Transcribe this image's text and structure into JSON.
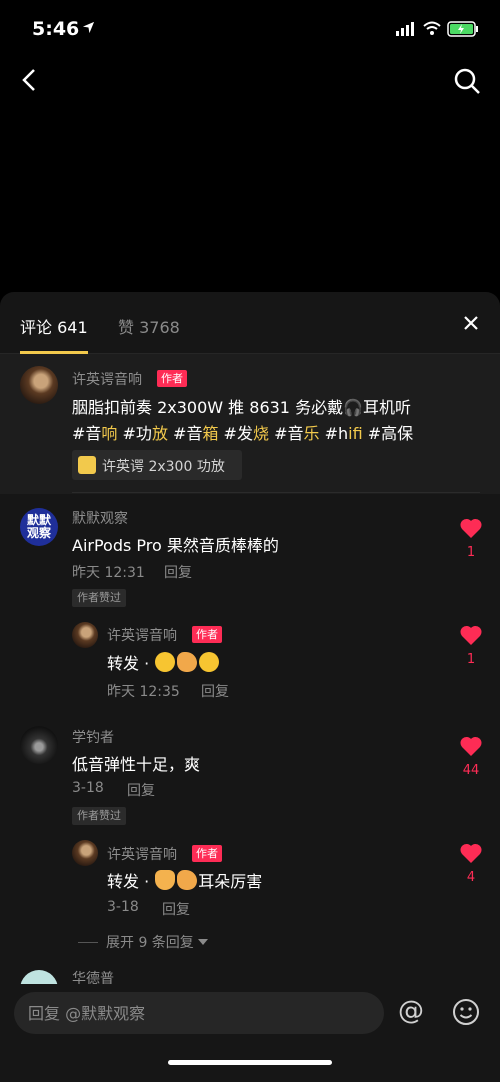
{
  "status": {
    "time": "5:46"
  },
  "tabs": {
    "comments": "评论 641",
    "likes": "赞 3768"
  },
  "pinned": {
    "username": "许英谔音响",
    "author_badge": "作者",
    "line1": "胭脂扣前奏 2x300W 推 8631 务必戴🎧耳机听",
    "tags": [
      {
        "a": "#音",
        "b": "响"
      },
      {
        "a": " #功",
        "b": "放"
      },
      {
        "a": " #音",
        "b": "箱"
      },
      {
        "a": " #发",
        "b": "烧"
      },
      {
        "a": " #音",
        "b": "乐"
      },
      {
        "a": " #h",
        "b": "ifi"
      },
      {
        "a": " #高保",
        "b": ""
      }
    ],
    "product": "许英谔 2x300 功放"
  },
  "comments": [
    {
      "username": "默默观察",
      "avatar_text": [
        "默默",
        "观察"
      ],
      "text": "AirPods Pro 果然音质棒棒的",
      "time": "昨天 12:31",
      "reply": "回复",
      "liked_by_author": "作者赞过",
      "likes": "1"
    },
    {
      "username": "许英谔音响",
      "author_badge": "作者",
      "text": "转发 ·",
      "time": "昨天 12:35",
      "reply": "回复",
      "likes": "1"
    },
    {
      "username": "学钓者",
      "text": "低音弹性十足，爽",
      "time": "3-18",
      "reply": "回复",
      "liked_by_author": "作者赞过",
      "likes": "44"
    },
    {
      "username": "许英谔音响",
      "author_badge": "作者",
      "text_before": "转发 ·",
      "text_after": "耳朵厉害",
      "time": "3-18",
      "reply": "回复",
      "likes": "4"
    },
    {
      "username": "华德普"
    }
  ],
  "expand": "展开 9 条回复",
  "input": {
    "placeholder": "回复 @默默观察"
  },
  "bottom": {
    "at": "@"
  },
  "colors": {
    "accent": "#fe2c55",
    "highlight": "#f2c94c",
    "sheet": "#161616"
  }
}
